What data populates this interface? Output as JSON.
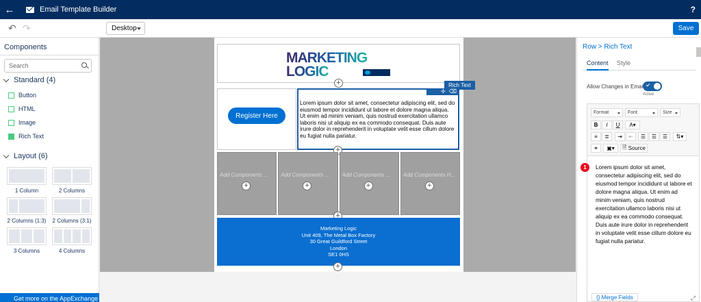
{
  "topbar": {
    "title": "Email Template Builder",
    "help": "?"
  },
  "toolbar": {
    "device": "Desktop",
    "save_label": "Save"
  },
  "left": {
    "title": "Components",
    "search_placeholder": "Search",
    "standard_label": "Standard (4)",
    "components": [
      "Button",
      "HTML",
      "Image",
      "Rich Text"
    ],
    "layout_label": "Layout (6)",
    "layouts": [
      "1 Column",
      "2 Columns",
      "2 Columns (1:3)",
      "2 Columns (3:1)",
      "3 Columns",
      "4 Columns"
    ],
    "appexchange": "Get more on the AppExchange"
  },
  "email": {
    "logo_line1": "MARKETING",
    "logo_line2": "LOGIC",
    "register_button": "Register Here",
    "rich_text_tab": "Rich Text",
    "body_text": "Lorem ipsum dolor sit amet, consectetur adipiscing elit, sed do eiusmod tempor incididunt ut labore et dolore magna aliqua. Ut enim ad minim veniam, quis nostrud exercitation ullamco laboris nisi ut aliquip ex ea commodo consequat. Duis aute irure dolor in reprehenderit in voluptate velit esse cillum dolore eu fugiat nulla pariatur.",
    "column_placeholders": [
      "Add Components ...",
      "Add Components ...",
      "Add Components ...",
      "Add Components H..."
    ],
    "footer_lines": [
      "Marketing Logic",
      "Unit 409, The Metal Box Factory",
      "30 Great Guildford Street",
      "London",
      "SE1 0HS"
    ]
  },
  "right": {
    "breadcrumb": "Row > Rich Text",
    "tab_content": "Content",
    "tab_style": "Style",
    "allow_changes": "Allow Changes in Email",
    "active": "Active",
    "format": "Format",
    "font": "Font",
    "size": "Size",
    "source": "Source",
    "badge": "1",
    "editor_text": "Lorem ipsum dolor sit amet, consectetur adipiscing elit, sed do eiusmod tempor incididunt ut labore et dolore magna aliqua. Ut enim ad minim veniam, quis nostrud exercitation ullamco laboris nisi ut aliquip ex ea commodo consequat. Duis aute irure dolor in reprehenderit in voluptate velit esse cillum dolore eu fugiat nulla pariatur.",
    "merge_fields": "Merge Fields"
  }
}
